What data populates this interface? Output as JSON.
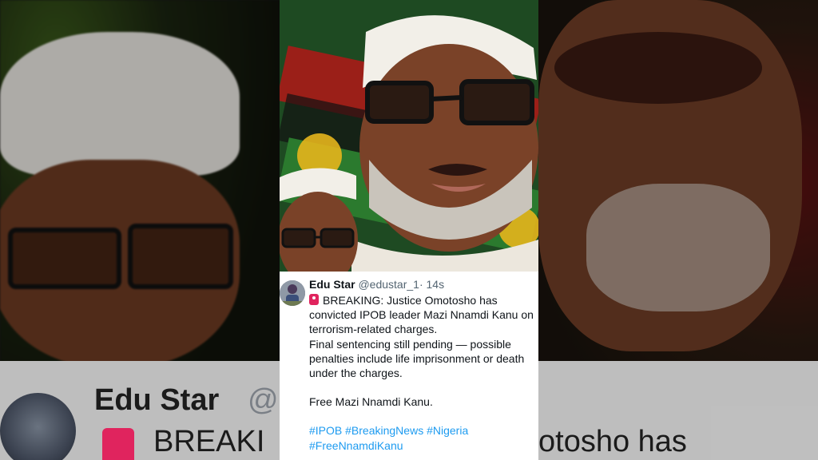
{
  "tweet": {
    "name": "Edu Star",
    "handle": "@edustar_1",
    "time": "· 14s",
    "lines": [
      "BREAKING: Justice Omotosho has",
      "convicted IPOB leader Mazi Nnamdi Kanu on",
      "terrorism-related charges.",
      "Final sentencing still pending — possible",
      "penalties include life imprisonment or death",
      "under the charges."
    ],
    "closing": "Free Mazi Nnamdi Kanu.",
    "hashtags_line1": [
      "#IPOB",
      "#BreakingNews",
      "#Nigeria"
    ],
    "hashtags_line2": [
      "#FreeNnamdiKanu"
    ]
  },
  "background_zoom": {
    "name": "Edu Star",
    "handle": "@",
    "text_left": "BREAKI",
    "text_right": "otosho has"
  },
  "colors": {
    "hashtag": "#1d9bf0",
    "siren": "#e0245e",
    "flag_green": "#2e7a35",
    "flag_red": "#8a2a18"
  },
  "icons": {
    "siren": "police-light-icon"
  }
}
